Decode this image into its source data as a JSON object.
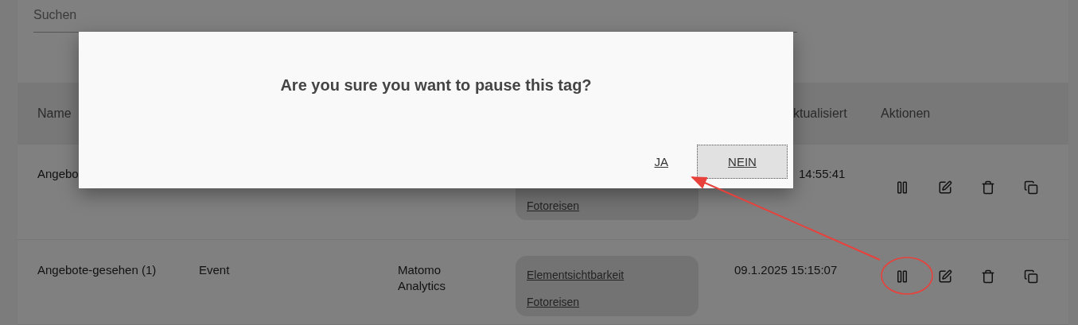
{
  "search": {
    "placeholder": "Suchen"
  },
  "table": {
    "header": {
      "name": "Name",
      "updated": "ktualisiert",
      "actions": "Aktionen"
    },
    "rows": [
      {
        "name": "Angebo",
        "tags": [
          "Fotoreisen"
        ],
        "updated": "14:55:41"
      },
      {
        "name": "Angebote-gesehen (1)",
        "type": "Event",
        "tool": "Matomo Analytics",
        "tags": [
          "Elementsichtbarkeit",
          "Fotoreisen"
        ],
        "updated": "09.1.2025 15:15:07"
      }
    ]
  },
  "dialog": {
    "message": "Are you sure you want to pause this tag?",
    "buttons": [
      {
        "label": "JA",
        "kind": "link",
        "focused": false
      },
      {
        "label": "NEIN",
        "kind": "button",
        "focused": true
      }
    ]
  }
}
